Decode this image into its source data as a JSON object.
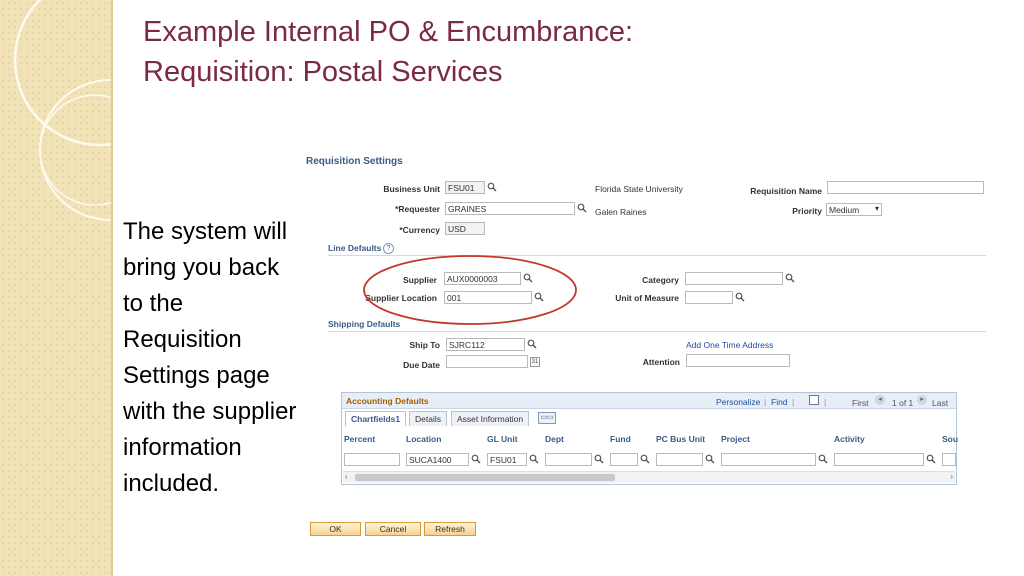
{
  "slide": {
    "title_line1": "Example Internal PO & Encumbrance:",
    "title_line2": "Requisition: Postal Services",
    "note": "The system will bring you back to the Requisition Settings page with the supplier information included."
  },
  "req": {
    "heading": "Requisition Settings",
    "business_unit_label": "Business Unit",
    "business_unit_value": "FSU01",
    "business_unit_desc": "Florida State University",
    "requester_label": "*Requester",
    "requester_value": "GRAINES",
    "requester_desc": "Galen Raines",
    "currency_label": "*Currency",
    "currency_value": "USD",
    "req_name_label": "Requisition Name",
    "req_name_value": "",
    "priority_label": "Priority",
    "priority_value": "Medium"
  },
  "line_defaults": {
    "heading": "Line Defaults",
    "help": "?",
    "supplier_label": "Supplier",
    "supplier_value": "AUX0000003",
    "supplier_location_label": "Supplier Location",
    "supplier_location_value": "001",
    "category_label": "Category",
    "category_value": "",
    "uom_label": "Unit of Measure",
    "uom_value": ""
  },
  "shipping": {
    "heading": "Shipping Defaults",
    "ship_to_label": "Ship To",
    "ship_to_value": "SJRC112",
    "add_address_link": "Add One Time Address",
    "due_date_label": "Due Date",
    "due_date_value": "",
    "attention_label": "Attention",
    "attention_value": ""
  },
  "acct": {
    "heading": "Accounting Defaults",
    "personalize": "Personalize",
    "find": "Find",
    "first": "First",
    "range": "1 of 1",
    "last": "Last",
    "tabs": [
      "Chartfields1",
      "Details",
      "Asset Information"
    ],
    "columns": [
      "Percent",
      "Location",
      "GL Unit",
      "Dept",
      "Fund",
      "PC Bus Unit",
      "Project",
      "Activity",
      "Sou"
    ],
    "row": {
      "percent": "",
      "location": "SUCA1400",
      "gl_unit": "FSU01",
      "dept": "",
      "fund": "",
      "pc_bus_unit": "",
      "project": "",
      "activity": ""
    }
  },
  "buttons": {
    "ok": "OK",
    "cancel": "Cancel",
    "refresh": "Refresh"
  },
  "colors": {
    "title": "#7b2a46",
    "section": "#3a5b86",
    "highlight_ellipse": "#c0392b",
    "side_band": "#f1e2b8"
  },
  "icons": [
    "magnifier-icon",
    "calendar-icon",
    "help-icon",
    "spreadsheet-icon",
    "first-arrow-icon",
    "last-arrow-icon",
    "scroll-left-icon",
    "scroll-right-icon"
  ]
}
